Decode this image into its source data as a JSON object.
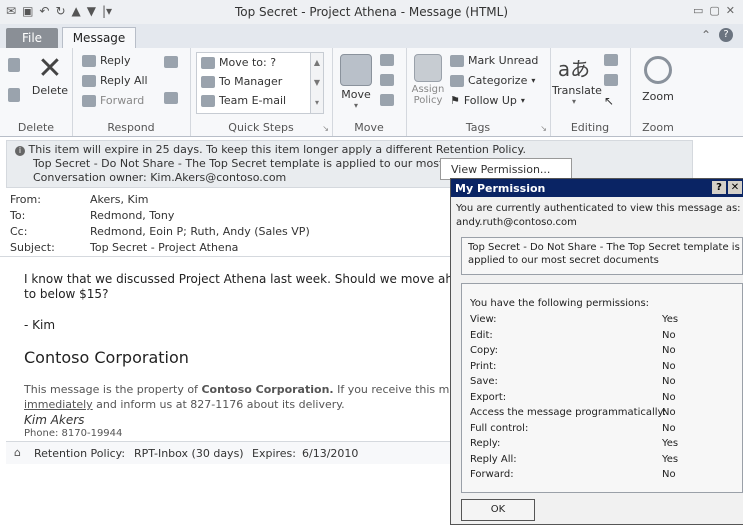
{
  "window": {
    "title": "Top Secret - Project Athena  -  Message (HTML)"
  },
  "tabs": {
    "file": "File",
    "message": "Message"
  },
  "ribbon": {
    "delete": {
      "button": "Delete",
      "group": "Delete"
    },
    "respond": {
      "reply": "Reply",
      "reply_all": "Reply All",
      "forward": "Forward",
      "group": "Respond"
    },
    "quick_steps": {
      "items": [
        "Move to: ?",
        "To Manager",
        "Team E-mail"
      ],
      "group": "Quick Steps"
    },
    "move": {
      "button": "Move",
      "group": "Move"
    },
    "tags": {
      "assign_policy": "Assign\nPolicy",
      "mark_unread": "Mark Unread",
      "categorize": "Categorize",
      "follow_up": "Follow Up",
      "group": "Tags"
    },
    "editing": {
      "translate": "Translate",
      "group": "Editing"
    },
    "zoom": {
      "button": "Zoom",
      "group": "Zoom"
    }
  },
  "infobar": {
    "line1": "This item will expire in 25 days. To keep this item longer apply a different Retention Policy.",
    "line2": "Top Secret - Do Not Share - The Top Secret template is applied to our most secret d",
    "line3": "Conversation owner: Kim.Akers@contoso.com",
    "view_permission": "View Permission..."
  },
  "headers": {
    "from_label": "From:",
    "from": "Akers, Kim",
    "to_label": "To:",
    "to": "Redmond, Tony",
    "cc_label": "Cc:",
    "cc": "Redmond, Eoin P; Ruth, Andy (Sales VP)",
    "subject_label": "Subject:",
    "subject": "Top Secret - Project Athena"
  },
  "message_body": {
    "para1a": "I know that we discussed Project Athena last week. Should we move ahead n",
    "para1b": "to below $15?",
    "signoff": "- Kim",
    "company": "Contoso Corporation",
    "disclaimer_a_pre": "This message is the property of ",
    "disclaimer_a_bold": "Contoso Corporation.",
    "disclaimer_a_post": " If you receive this m",
    "disclaimer_b_link": "immediately",
    "disclaimer_b_rest": " and inform us at 827-1176 about its delivery.",
    "signature_name": "Kim Akers",
    "phone": "Phone: 8170-19944"
  },
  "retention": {
    "policy_label": "Retention Policy:",
    "policy": "RPT-Inbox (30 days)",
    "expires_label": "Expires:",
    "expires": "6/13/2010"
  },
  "dialog": {
    "title": "My Permission",
    "help": "?",
    "auth_line1": "You are currently authenticated to view this message as:",
    "auth_line2": "andy.ruth@contoso.com",
    "template_line1": "Top Secret - Do Not Share - The Top Secret template is",
    "template_line2": "applied to our most secret documents",
    "permissions_heading": "You have the following permissions:",
    "permissions": [
      {
        "name": "View:",
        "value": "Yes"
      },
      {
        "name": "Edit:",
        "value": "No"
      },
      {
        "name": "Copy:",
        "value": "No"
      },
      {
        "name": "Print:",
        "value": "No"
      },
      {
        "name": "Save:",
        "value": "No"
      },
      {
        "name": "Export:",
        "value": "No"
      },
      {
        "name": "Access the message programmatically:",
        "value": "No"
      },
      {
        "name": "Full control:",
        "value": "No"
      },
      {
        "name": "Reply:",
        "value": "Yes"
      },
      {
        "name": "Reply All:",
        "value": "Yes"
      },
      {
        "name": "Forward:",
        "value": "No"
      }
    ],
    "ok": "OK"
  }
}
